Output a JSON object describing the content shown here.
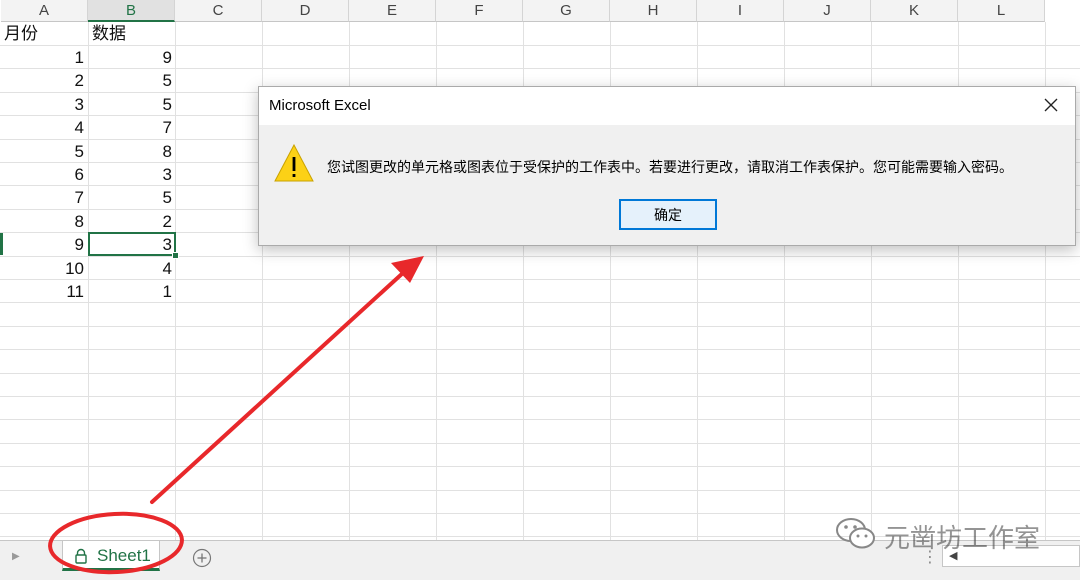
{
  "columns": [
    "A",
    "B",
    "C",
    "D",
    "E",
    "F",
    "G",
    "H",
    "I",
    "J",
    "K",
    "L"
  ],
  "selected_column": "B",
  "headers": {
    "A": "月份",
    "B": "数据"
  },
  "rows": [
    {
      "a": "1",
      "b": "9"
    },
    {
      "a": "2",
      "b": "5"
    },
    {
      "a": "3",
      "b": "5"
    },
    {
      "a": "4",
      "b": "7"
    },
    {
      "a": "5",
      "b": "8"
    },
    {
      "a": "6",
      "b": "3"
    },
    {
      "a": "7",
      "b": "5"
    },
    {
      "a": "8",
      "b": "2"
    },
    {
      "a": "9",
      "b": "3"
    },
    {
      "a": "10",
      "b": "4"
    },
    {
      "a": "11",
      "b": "1"
    }
  ],
  "dialog": {
    "title": "Microsoft Excel",
    "message": "您试图更改的单元格或图表位于受保护的工作表中。若要进行更改，请取消工作表保护。您可能需要输入密码。",
    "ok_label": "确定",
    "icon": "warning-icon"
  },
  "sheet_tab": {
    "label": "Sheet1",
    "icon": "lock-icon"
  },
  "watermark": {
    "text": "元凿坊工作室",
    "icon": "wechat-icon"
  },
  "colors": {
    "excel_green": "#217346",
    "annotation_red": "#e8282b",
    "dialog_button_border": "#0078d7",
    "warning_yellow": "#fcd116"
  }
}
